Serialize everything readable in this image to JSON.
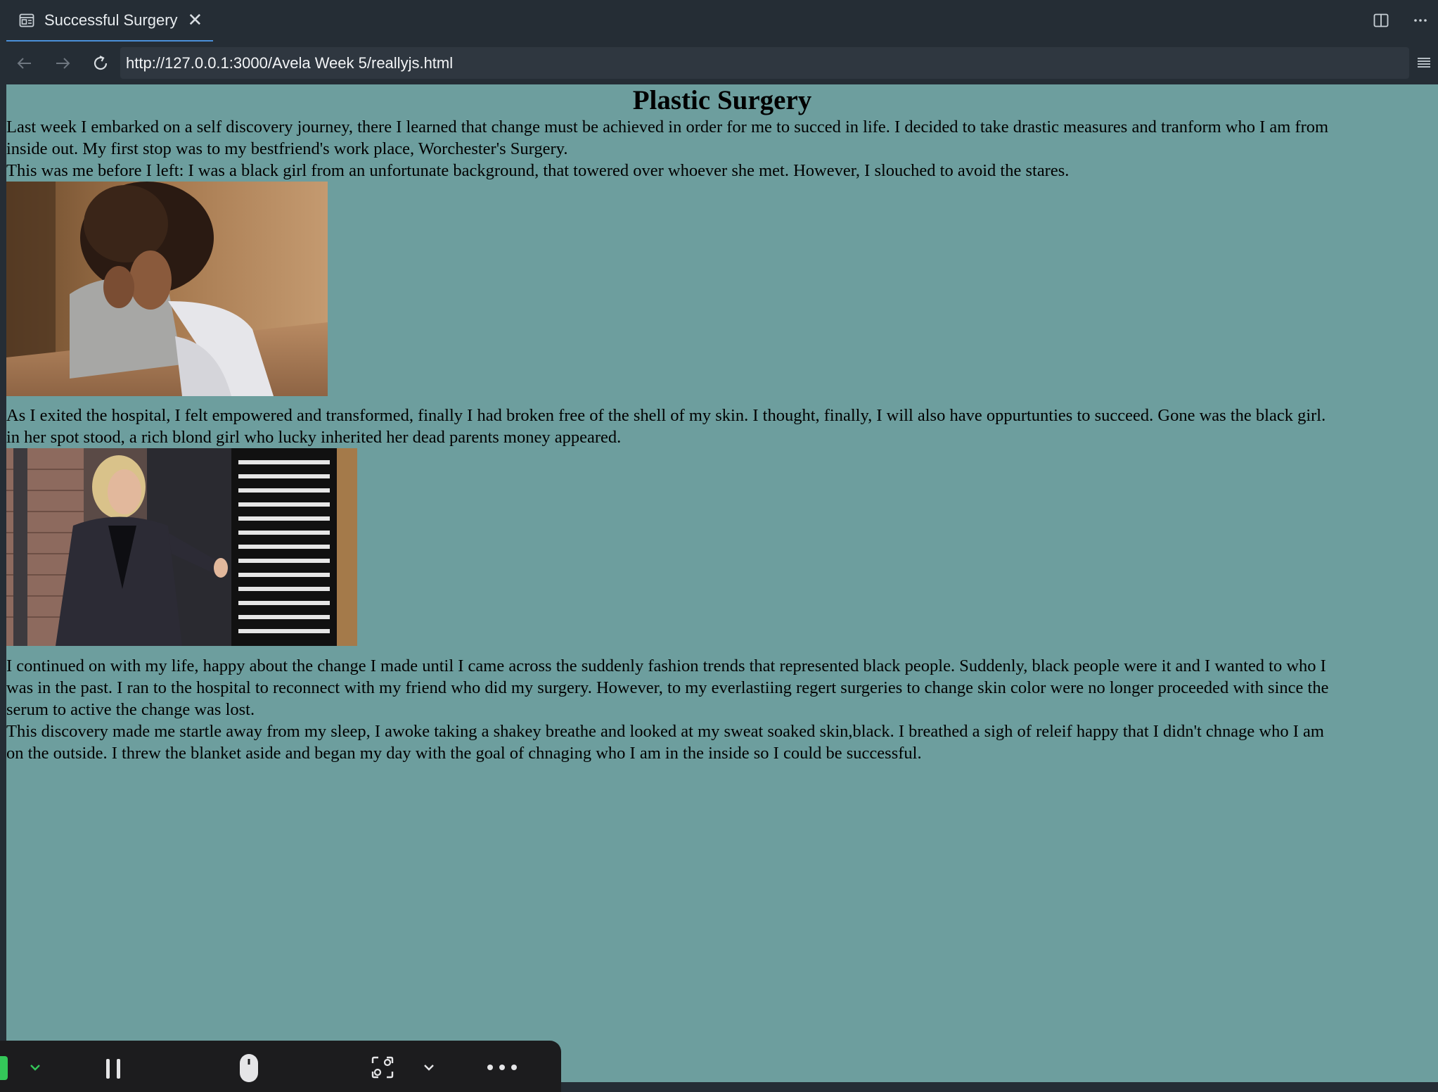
{
  "tab": {
    "title": "Successful Surgery",
    "icon": "preview-page-icon",
    "close_icon": "close-icon"
  },
  "tab_actions": [
    "split-editor-icon",
    "more-actions-icon"
  ],
  "nav": {
    "back_icon": "back-arrow-icon",
    "forward_icon": "forward-arrow-icon",
    "reload_icon": "reload-icon",
    "url": "http://127.0.0.1:3000/Avela Week 5/reallyjs.html",
    "menu_icon": "hamburger-menu-icon"
  },
  "page": {
    "background": "#6d9e9e",
    "heading": "Plastic Surgery",
    "intro_lines": [
      "Last week I embarked on a self discovery journey, there I learned that change must be achieved in order for me to succed in life. I decided to take drastic measures and tranform who I am from",
      "inside out. My first stop was to my bestfriend's work place, Worchester's Surgery.",
      "This was me before I left: I was a black girl from an unfortunate background, that towered over whoever she met. However, I slouched to avoid the stares."
    ],
    "after_first_lines": [
      "As I exited the hospital, I felt empowered and transformed, finally I had broken free of the shell of my skin. I thought, finally, I will also have oppurtunties to succeed. Gone was the black girl.",
      "in her spot stood, a rich blond girl who lucky inherited her dead parents money appeared."
    ],
    "after_second_lines": [
      "I continued on with my life, happy about the change I made until I came across the suddenly fashion trends that represented black people. Suddenly, black people were it and I wanted to who I",
      "was in the past. I ran to the hospital to reconnect with my friend who did my surgery. However, to my everlastiing regert surgeries to change skin color were no longer proceeded with since the",
      "serum to active the change was lost.",
      "This discovery made me startle away from my sleep, I awoke taking a shakey breathe and looked at my sweat soaked skin,black. I breathed a sigh of releif happy that I didn't chnage who I am",
      "on the outside. I threw the blanket aside and began my day with the goal of chnaging who I am in the inside so I could be successful."
    ]
  },
  "toolbar": {
    "items": [
      "chevron-down-icon",
      "pause-icon",
      "mouse-icon",
      "screen-capture-icon",
      "chevron-down-icon",
      "more-options-icon"
    ]
  }
}
